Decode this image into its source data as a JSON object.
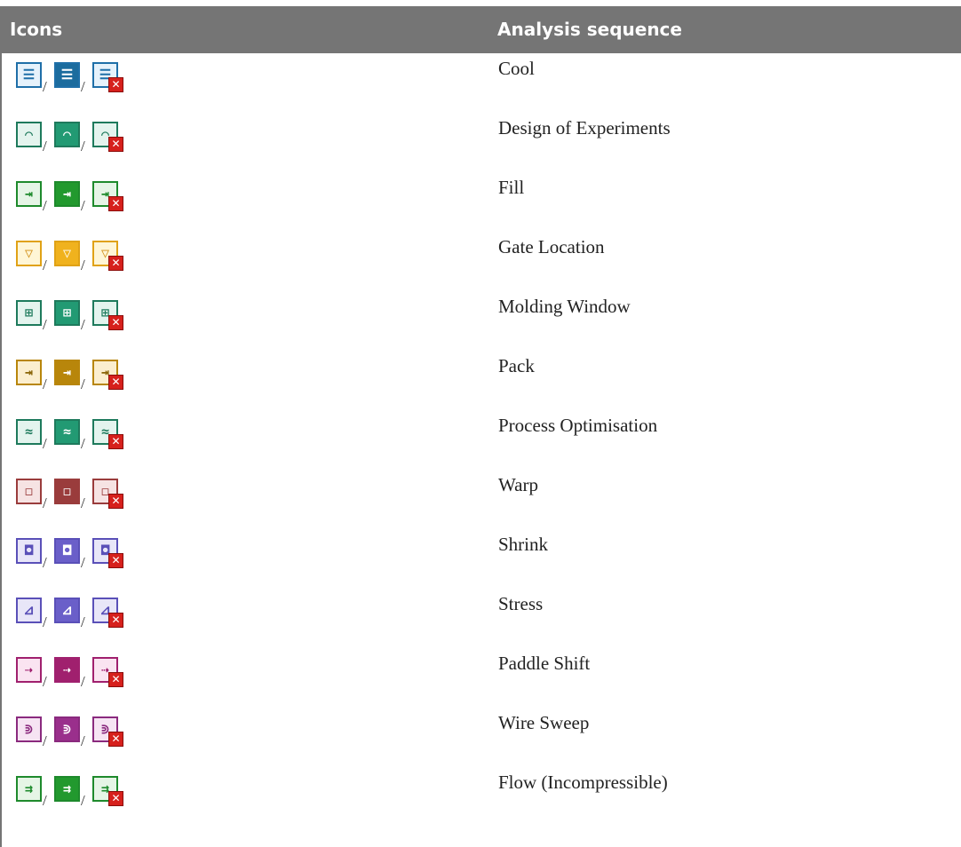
{
  "header": {
    "col_icons": "Icons",
    "col_sequence": "Analysis sequence"
  },
  "rows": [
    {
      "name": "Cool",
      "icon": "cool-icon",
      "glyph": "☰",
      "border": "#1f6fa8",
      "light": "#e6f2fb",
      "dark": "#1c6c9e",
      "glyph_light": "#1f6fa8",
      "glyph_dark": "#ffffff"
    },
    {
      "name": "Design of Experiments",
      "icon": "design-of-experiments-icon",
      "glyph": "⌒",
      "border": "#1e7a5c",
      "light": "#e4f4ee",
      "dark": "#229a73",
      "glyph_light": "#1e7a5c",
      "glyph_dark": "#ffffff"
    },
    {
      "name": "Fill",
      "icon": "fill-icon",
      "glyph": "⇥",
      "border": "#1e8a2c",
      "light": "#e6f5e6",
      "dark": "#22992e",
      "glyph_light": "#1e8a2c",
      "glyph_dark": "#ffffff"
    },
    {
      "name": "Gate Location",
      "icon": "gate-location-icon",
      "glyph": "▽",
      "border": "#e0a216",
      "light": "#fff6d6",
      "dark": "#f0b21e",
      "glyph_light": "#d08c10",
      "glyph_dark": "#ffffff"
    },
    {
      "name": "Molding Window",
      "icon": "molding-window-icon",
      "glyph": "⊞",
      "border": "#1e7a5c",
      "light": "#e4f4ee",
      "dark": "#229a73",
      "glyph_light": "#1e7a5c",
      "glyph_dark": "#ffffff"
    },
    {
      "name": "Pack",
      "icon": "pack-icon",
      "glyph": "⇥",
      "border": "#b8860b",
      "light": "#fbeecf",
      "dark": "#b8860b",
      "glyph_light": "#8a6508",
      "glyph_dark": "#ffffff"
    },
    {
      "name": "Process Optimisation",
      "icon": "process-optimisation-icon",
      "glyph": "≈",
      "border": "#1e7a5c",
      "light": "#e4f4ee",
      "dark": "#229a73",
      "glyph_light": "#1e7a5c",
      "glyph_dark": "#ffffff"
    },
    {
      "name": "Warp",
      "icon": "warp-icon",
      "glyph": "◻",
      "border": "#9a3c3c",
      "light": "#f6e3e3",
      "dark": "#9a3c3c",
      "glyph_light": "#9a3c3c",
      "glyph_dark": "#ffffff"
    },
    {
      "name": "Shrink",
      "icon": "shrink-icon",
      "glyph": "◘",
      "border": "#5a50b8",
      "light": "#e8e6f8",
      "dark": "#6a5fc9",
      "glyph_light": "#5a50b8",
      "glyph_dark": "#ffffff"
    },
    {
      "name": "Stress",
      "icon": "stress-icon",
      "glyph": "⊿",
      "border": "#5a50b8",
      "light": "#e8e6f8",
      "dark": "#6a5fc9",
      "glyph_light": "#5a50b8",
      "glyph_dark": "#ffffff"
    },
    {
      "name": "Paddle Shift",
      "icon": "paddle-shift-icon",
      "glyph": "⇢",
      "border": "#a0206e",
      "light": "#fae4f1",
      "dark": "#a0206e",
      "glyph_light": "#a0206e",
      "glyph_dark": "#ffffff"
    },
    {
      "name": "Wire Sweep",
      "icon": "wire-sweep-icon",
      "glyph": "⋑",
      "border": "#8a2a7e",
      "light": "#f6e4f3",
      "dark": "#9a2f8c",
      "glyph_light": "#8a2a7e",
      "glyph_dark": "#ffffff"
    },
    {
      "name": "Flow (Incompressible)",
      "icon": "flow-incompressible-icon",
      "glyph": "⇉",
      "border": "#1e8a2c",
      "light": "#e6f5e6",
      "dark": "#22992e",
      "glyph_light": "#1e8a2c",
      "glyph_dark": "#ffffff"
    }
  ],
  "separator": "/",
  "error_badge": "✕"
}
